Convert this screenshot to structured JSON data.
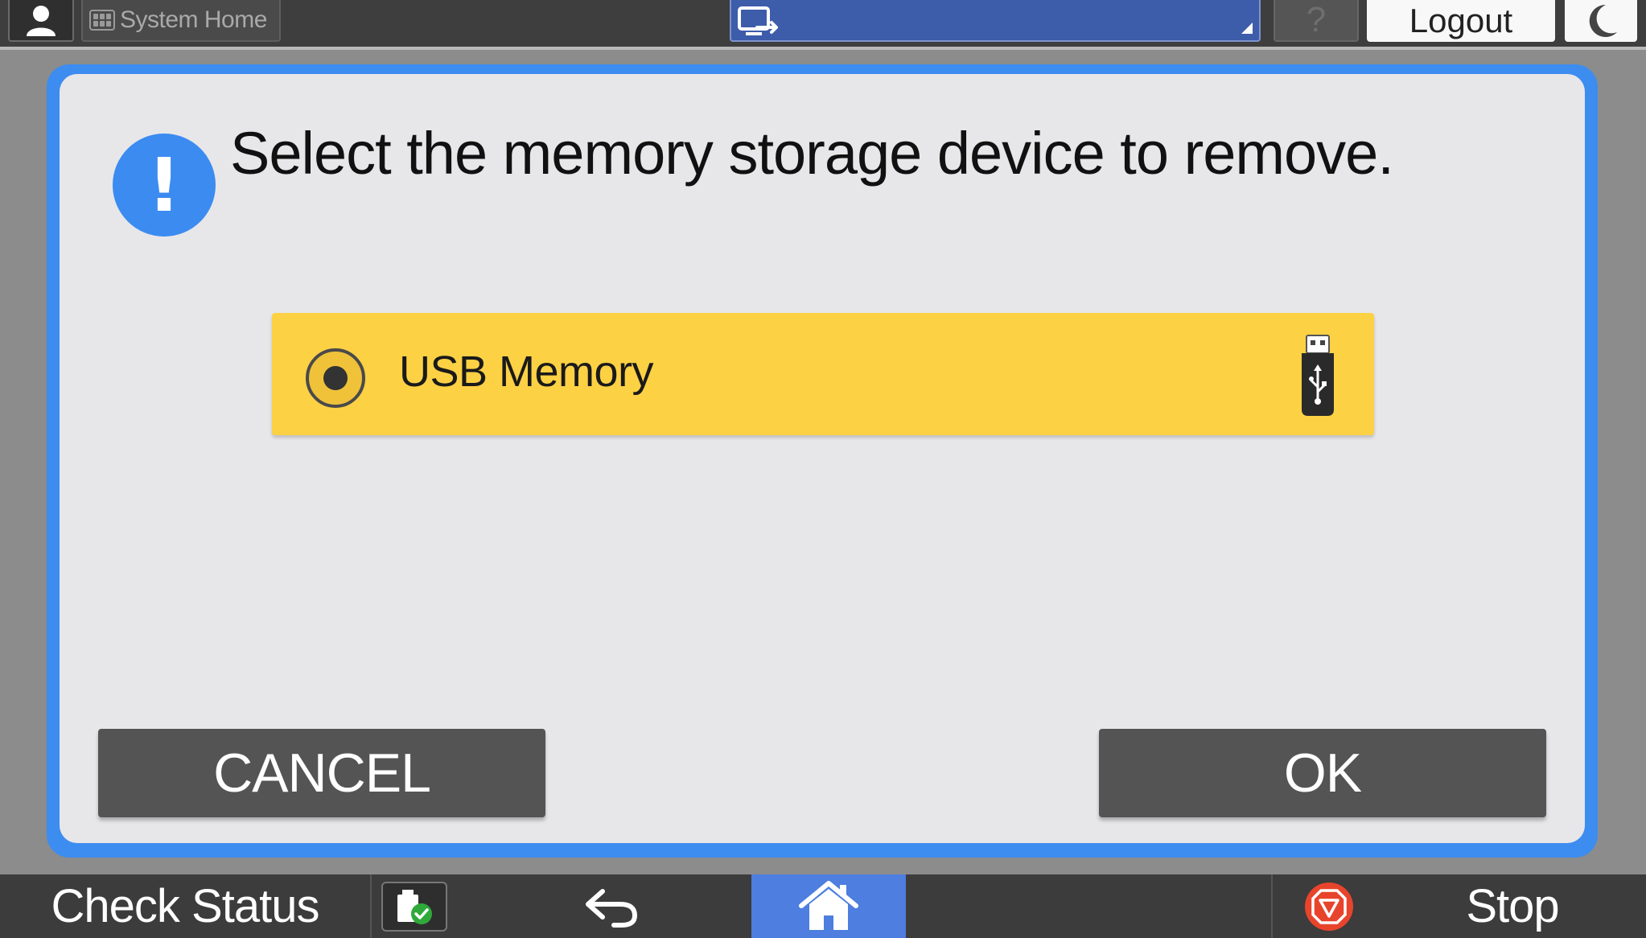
{
  "top_bar": {
    "system_home_label": "System Home",
    "help_label": "?",
    "logout_label": "Logout"
  },
  "dialog": {
    "message": "Select the memory storage device to remove.",
    "devices": [
      {
        "label": "USB Memory",
        "selected": true,
        "icon": "usb-drive-icon"
      }
    ],
    "cancel_label": "CANCEL",
    "ok_label": "OK"
  },
  "bottom_bar": {
    "check_status_label": "Check Status",
    "stop_label": "Stop"
  },
  "colors": {
    "accent_blue": "#3d8cf0",
    "selection_yellow": "#fdd144",
    "button_gray": "#545454",
    "home_blue": "#4d7ee0",
    "stop_red": "#e8442c"
  }
}
